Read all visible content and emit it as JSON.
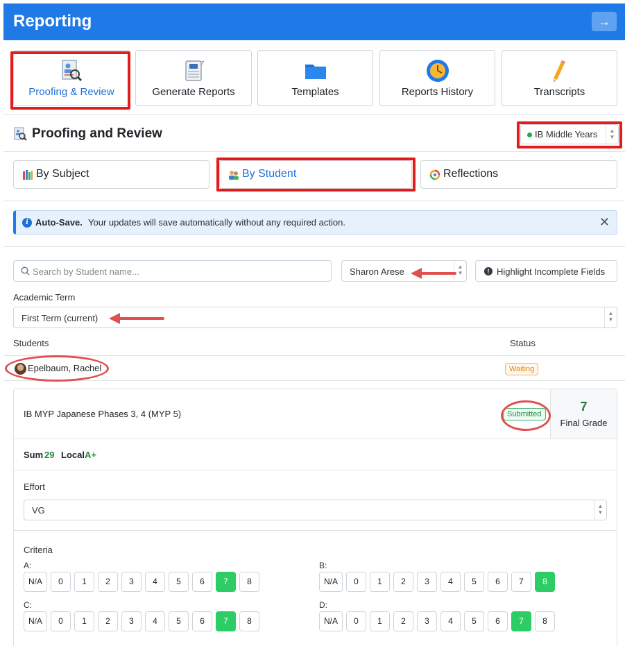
{
  "header": {
    "title": "Reporting",
    "exit_icon": "→"
  },
  "tiles": [
    {
      "label": "Proofing & Review",
      "icon": "proofing-icon",
      "active": true
    },
    {
      "label": "Generate Reports",
      "icon": "report-cards-icon",
      "active": false
    },
    {
      "label": "Templates",
      "icon": "folder-icon",
      "active": false
    },
    {
      "label": "Reports History",
      "icon": "clock-icon",
      "active": false
    },
    {
      "label": "Transcripts",
      "icon": "pencil-icon",
      "active": false
    }
  ],
  "section": {
    "title": "Proofing and Review",
    "program": "IB Middle Years"
  },
  "subtabs": [
    {
      "label": "By Subject",
      "active": false
    },
    {
      "label": "By Student",
      "active": true
    },
    {
      "label": "Reflections",
      "active": false
    }
  ],
  "alert": {
    "title": "Auto-Save.",
    "message": "Your updates will save automatically without any required action.",
    "close": "✕"
  },
  "filters": {
    "search_placeholder": "Search by Student name...",
    "teacher": "Sharon Arese",
    "highlight_label": "Highlight Incomplete Fields",
    "term_label": "Academic Term",
    "term": "First Term (current)"
  },
  "students": {
    "col_students": "Students",
    "col_status": "Status",
    "name": "Epelbaum, Rachel",
    "status": "Waiting"
  },
  "card": {
    "subject": "IB MYP Japanese Phases 3, 4 (MYP 5)",
    "status": "Submitted",
    "final_grade": "7",
    "final_label": "Final Grade",
    "sum_label": "Sum",
    "sum_value": "29",
    "local_label": "Local",
    "local_value": "A+",
    "effort_label": "Effort",
    "effort_value": "VG",
    "criteria_label": "Criteria",
    "scale": [
      "N/A",
      "0",
      "1",
      "2",
      "3",
      "4",
      "5",
      "6",
      "7",
      "8"
    ],
    "criteria": [
      {
        "label": "A:",
        "selected": "7"
      },
      {
        "label": "B:",
        "selected": "8"
      },
      {
        "label": "C:",
        "selected": "7"
      },
      {
        "label": "D:",
        "selected": "7"
      }
    ]
  },
  "colors": {
    "header": "#1f7ae8",
    "accent": "#1f6fd6",
    "selected": "#2ecc65",
    "annotation": "#e41b1b"
  }
}
